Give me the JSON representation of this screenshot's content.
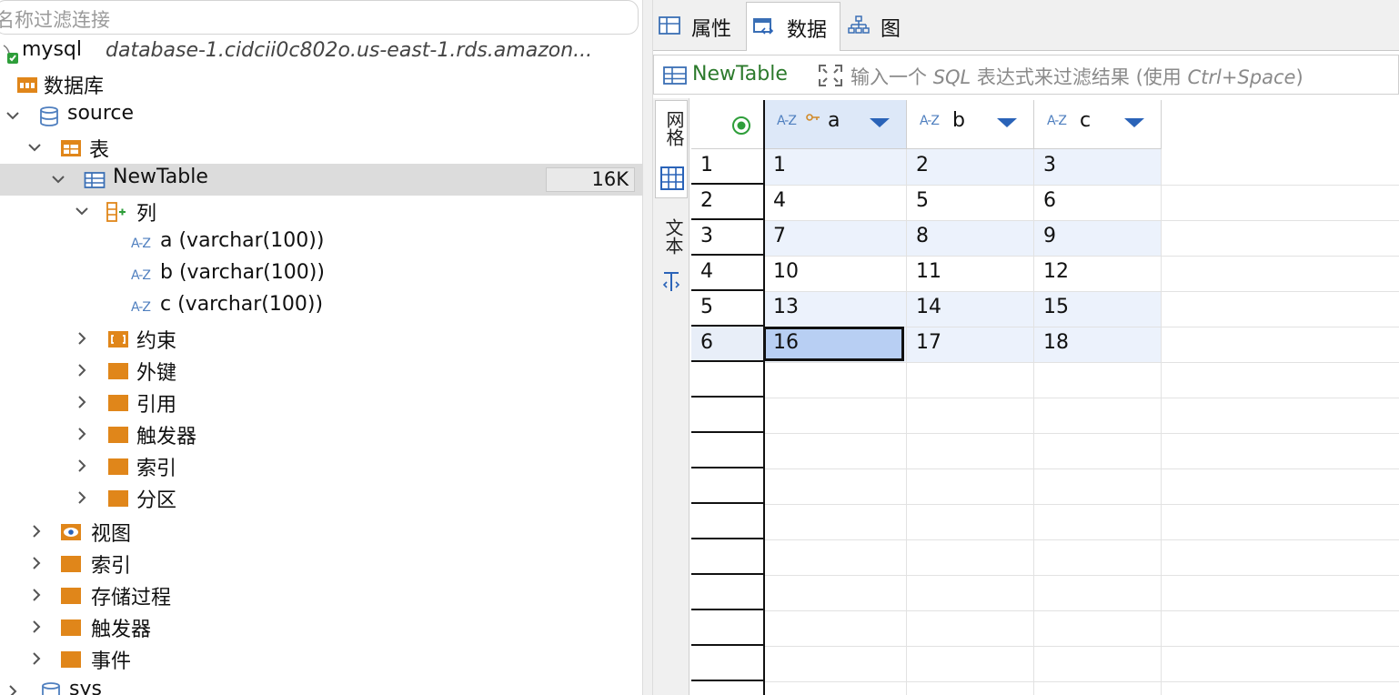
{
  "navigator": {
    "filter_placeholder": "名称过滤连接",
    "connection": {
      "name": "mysql",
      "description": "database-1.cidcii0c802o.us-east-1.rds.amazon..."
    },
    "databases_label": "数据库",
    "schema": "source",
    "tables_label": "表",
    "selected_table": {
      "name": "NewTable",
      "size": "16K"
    },
    "columns_label": "列",
    "columns": [
      {
        "type_icon": "A-Z",
        "label": "a (varchar(100))"
      },
      {
        "type_icon": "A-Z",
        "label": "b (varchar(100))"
      },
      {
        "type_icon": "A-Z",
        "label": "c (varchar(100))"
      }
    ],
    "table_children": [
      "约束",
      "外键",
      "引用",
      "触发器",
      "索引",
      "分区"
    ],
    "schema_children": [
      "视图",
      "索引",
      "存储过程",
      "触发器",
      "事件"
    ],
    "next_schema": "sys"
  },
  "editor": {
    "tabs": [
      {
        "label": "属性",
        "icon": "table-icon"
      },
      {
        "label": "数据",
        "icon": "data-icon"
      },
      {
        "label": "图",
        "icon": "diagram-icon"
      }
    ],
    "active_tab": "数据",
    "filter_bar": {
      "table": "NewTable",
      "hint_prefix": "输入一个 ",
      "hint_sql": "SQL",
      "hint_middle": " 表达式来过滤结果 (使用 ",
      "hint_keys": "Ctrl+Space",
      "hint_suffix": ")"
    },
    "view_tabs": [
      "网格",
      "文本"
    ],
    "grid": {
      "columns": [
        {
          "type_icon": "A-Z",
          "name": "a",
          "key": true
        },
        {
          "type_icon": "A-Z",
          "name": "b",
          "key": false
        },
        {
          "type_icon": "A-Z",
          "name": "c",
          "key": false
        }
      ],
      "rows": [
        {
          "num": "1",
          "cells": [
            "1",
            "2",
            "3"
          ]
        },
        {
          "num": "2",
          "cells": [
            "4",
            "5",
            "6"
          ]
        },
        {
          "num": "3",
          "cells": [
            "7",
            "8",
            "9"
          ]
        },
        {
          "num": "4",
          "cells": [
            "10",
            "11",
            "12"
          ]
        },
        {
          "num": "5",
          "cells": [
            "13",
            "14",
            "15"
          ]
        },
        {
          "num": "6",
          "cells": [
            "16",
            "17",
            "18"
          ]
        }
      ],
      "selected_cell": {
        "row": 6,
        "column": "a"
      }
    }
  },
  "colors": {
    "folder": "#e0861a",
    "accent_blue": "#2a63b8",
    "selection": "#b8cff3",
    "row_band": "#ecf2fc"
  }
}
